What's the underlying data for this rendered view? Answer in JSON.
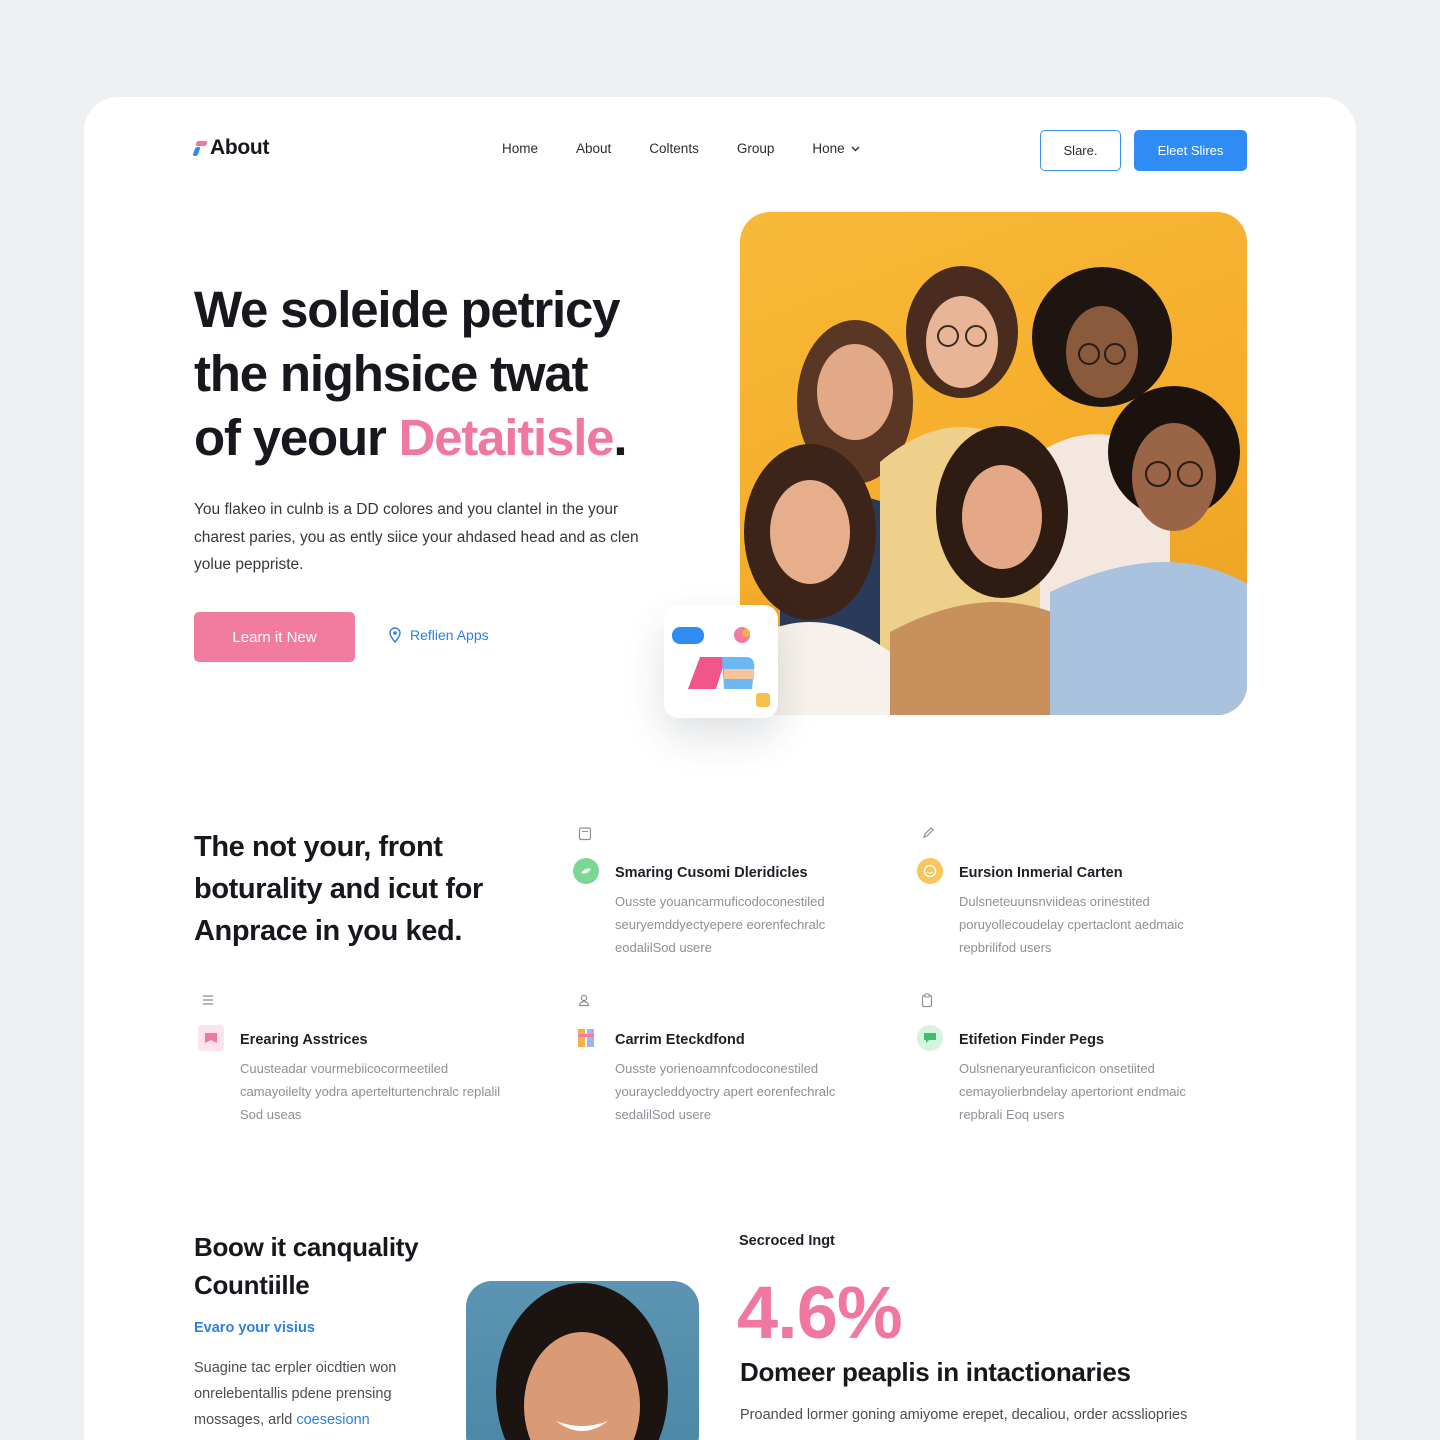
{
  "header": {
    "logo_text": "About",
    "nav": [
      {
        "label": "Home"
      },
      {
        "label": "About"
      },
      {
        "label": "Coltents"
      },
      {
        "label": "Group"
      },
      {
        "label": "Hone"
      }
    ],
    "outline_button": "Slare.",
    "primary_button": "Eleet Slires"
  },
  "hero": {
    "title_line1": "We soleide petricy",
    "title_line2": "the nighsice twat",
    "title_line3_prefix": "of yeour ",
    "title_accent": "Detaitisle",
    "title_end": ".",
    "paragraph": "You flakeo in culnb is a DD colores and you clantel in the your charest paries, you as ently siice your ahdased head and as clen yolue peppriste.",
    "cta_button": "Learn it New",
    "secondary_link": "Reflien Apps",
    "colors": {
      "accent": "#f0789f",
      "primary": "#2f8cf4",
      "photo_bg": "#f5ad2a"
    }
  },
  "features": {
    "title": "The not your, front boturality and icut for Anprace in you ked.",
    "items": [
      {
        "title": "Smaring Cusomi Dleridicles",
        "text": "Ousste youancarmuficodoconestiled seuryemddyectyepere eorenfechralc eodalilSod usere",
        "icon": "leaf-icon"
      },
      {
        "title": "Eursion Inmerial Carten",
        "text": "Dulsneteuunsnviideas orinestited poruyollecoudelay cpertaclont aedmaic repbrilifod users",
        "icon": "smile-icon"
      },
      {
        "title": "Erearing Asstrices",
        "text": "Cuusteadar vourmebiicocormeetiled camayoilelty yodra apertelturtenchralc replalil Sod useas",
        "icon": "bookmark-icon"
      },
      {
        "title": "Carrim Eteckdfond",
        "text": "Ousste yorienoamnfcodoconestiled youraycleddyoctry apert eorenfechralc sedalilSod usere",
        "icon": "book-icon"
      },
      {
        "title": "Etifetion Finder Pegs",
        "text": "Oulsnenaryeuranficicon onsetiited cemayolierbndelay apertoriont endmaic repbrali Eoq users",
        "icon": "chat-icon"
      }
    ]
  },
  "bottom": {
    "title": "Boow it canquality Countiille",
    "link": "Evaro your visius",
    "text_main": "Suagine tac erpler oicdtien won onrelebentallis pdene prensing mossages, arld ",
    "text_link": "coesesionn",
    "stat_label": "Secroced Ingt",
    "stat_value": "4.6%",
    "stat_title": "Domeer peaplis in intactionaries",
    "stat_text": "Proanded lormer goning amiyome erepet, decaliou, order acssliopries"
  }
}
